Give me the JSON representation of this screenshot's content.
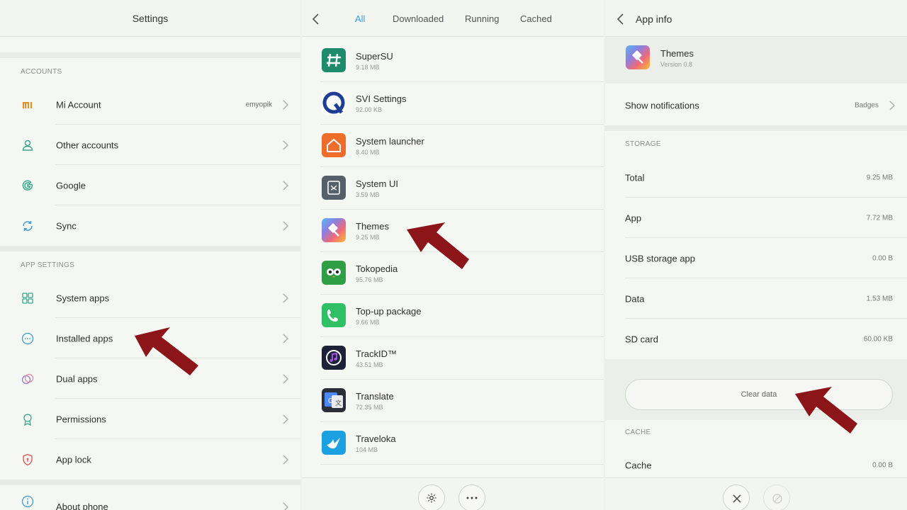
{
  "settings": {
    "title": "Settings",
    "accounts_label": "ACCOUNTS",
    "app_settings_label": "APP SETTINGS",
    "accounts": [
      {
        "label": "Mi Account",
        "value": "emyopik"
      },
      {
        "label": "Other accounts"
      },
      {
        "label": "Google"
      },
      {
        "label": "Sync"
      }
    ],
    "app_settings": [
      {
        "label": "System apps"
      },
      {
        "label": "Installed apps"
      },
      {
        "label": "Dual apps"
      },
      {
        "label": "Permissions"
      },
      {
        "label": "App lock"
      }
    ],
    "bottom_item": {
      "label": "About phone"
    }
  },
  "apps_list": {
    "tabs": [
      "All",
      "Downloaded",
      "Running",
      "Cached"
    ],
    "active_tab": "All",
    "apps": [
      {
        "name": "SuperSU",
        "size": "9.18 MB"
      },
      {
        "name": "SVI Settings",
        "size": "92.00 KB"
      },
      {
        "name": "System launcher",
        "size": "8.40 MB"
      },
      {
        "name": "System UI",
        "size": "3.59 MB"
      },
      {
        "name": "Themes",
        "size": "9.25 MB"
      },
      {
        "name": "Tokopedia",
        "size": "95.76 MB"
      },
      {
        "name": "Top-up package",
        "size": "9.66 MB"
      },
      {
        "name": "TrackID™",
        "size": "43.51 MB"
      },
      {
        "name": "Translate",
        "size": "72.35 MB"
      },
      {
        "name": "Traveloka",
        "size": "104 MB"
      }
    ]
  },
  "app_info": {
    "title": "App info",
    "app_name": "Themes",
    "version": "Version 0.8",
    "notifications_label": "Show notifications",
    "notifications_value": "Badges",
    "storage_label": "STORAGE",
    "storage_rows": [
      {
        "label": "Total",
        "value": "9.25 MB"
      },
      {
        "label": "App",
        "value": "7.72 MB"
      },
      {
        "label": "USB storage app",
        "value": "0.00 B"
      },
      {
        "label": "Data",
        "value": "1.53 MB"
      },
      {
        "label": "SD card",
        "value": "60.00 KB"
      }
    ],
    "clear_data_label": "Clear data",
    "cache_label": "CACHE",
    "cache_row": {
      "label": "Cache",
      "value": "0.00 B"
    }
  },
  "colors": {
    "accent": "#3d9ad8",
    "arrow": "#8b1518"
  }
}
